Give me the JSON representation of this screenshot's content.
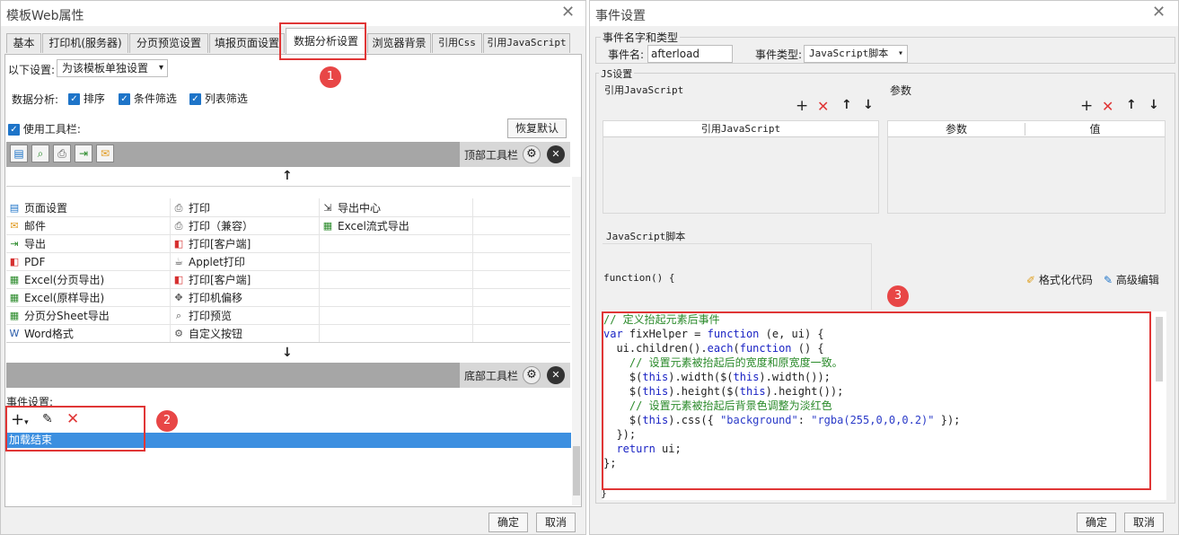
{
  "left": {
    "title": "模板Web属性",
    "tabs": [
      "基本",
      "打印机(服务器)",
      "分页预览设置",
      "填报页面设置",
      "数据分析设置",
      "浏览器背景",
      "引用Css",
      "引用JavaScript"
    ],
    "setting_label": "以下设置:",
    "setting_value": "为该模板单独设置",
    "analysis_label": "数据分析:",
    "analysis_options": [
      "排序",
      "条件筛选",
      "列表筛选"
    ],
    "use_toolbar_label": "使用工具栏:",
    "restore_default": "恢复默认",
    "top_toolbar_label": "顶部工具栏",
    "bottom_toolbar_label": "底部工具栏",
    "up_arrow": "↑",
    "down_arrow": "↓",
    "buttons_col1": [
      "页面设置",
      "邮件",
      "导出",
      "PDF",
      "Excel(分页导出)",
      "Excel(原样导出)",
      "分页分Sheet导出",
      "Word格式"
    ],
    "buttons_col2": [
      "打印",
      "打印（兼容）",
      "打印[客户端]",
      "Applet打印",
      "打印[客户端]",
      "打印机偏移",
      "打印预览",
      "自定义按钮"
    ],
    "buttons_col3": [
      "导出中心",
      "Excel流式导出"
    ],
    "event_label": "事件设置:",
    "event_item": "加载结束",
    "ok": "确定",
    "cancel": "取消"
  },
  "right": {
    "title": "事件设置",
    "group_name_type": "事件名字和类型",
    "event_name_label": "事件名:",
    "event_name_value": "afterload",
    "event_type_label": "事件类型:",
    "event_type_value": "JavaScript脚本",
    "js_settings": "JS设置",
    "ref_js_label": "引用JavaScript",
    "params_label": "参数",
    "ref_js_col": "引用JavaScript",
    "param_col": "参数",
    "value_col": "值",
    "js_script_label": "JavaScript脚本",
    "func_header": "function() {",
    "format_code": "格式化代码",
    "advanced_edit": "高级编辑",
    "ok": "确定",
    "cancel": "取消"
  },
  "markers": [
    "1",
    "2",
    "3"
  ],
  "code_lines": [
    "// 定义抬起元素后事件",
    "var fixHelper = function (e, ui) {",
    "  ui.children().each(function () {",
    "    // 设置元素被抬起后的宽度和原宽度一致。",
    "    $(this).width($(this).width());",
    "    $(this).height($(this).height());",
    "    // 设置元素被抬起后背景色调整为淡红色",
    "    $(this).css({ \"background\": \"rgba(255,0,0,0.2)\" });",
    "  });",
    "  return ui;",
    "};"
  ],
  "colors": {
    "accent": "#1e74c8",
    "selection": "#3c8fe0",
    "marker": "#e84646"
  }
}
